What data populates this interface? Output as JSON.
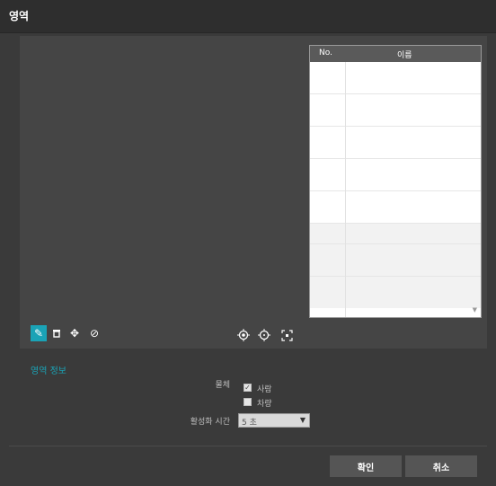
{
  "title": "영역",
  "table": {
    "headers": [
      "No.",
      "이름"
    ],
    "rows": [
      {
        "no": "",
        "name": ""
      },
      {
        "no": "",
        "name": ""
      },
      {
        "no": "",
        "name": ""
      },
      {
        "no": "",
        "name": ""
      },
      {
        "no": "",
        "name": ""
      },
      {
        "no": "",
        "name": ""
      },
      {
        "no": "",
        "name": ""
      },
      {
        "no": "",
        "name": ""
      }
    ]
  },
  "toolbar": {
    "left_icons": [
      "draw-icon",
      "delete-icon",
      "move-icon",
      "clear-icon"
    ],
    "right_icons": [
      "target-icon",
      "target-outline-icon",
      "fit-screen-icon"
    ],
    "active_color": "#1aa3b6"
  },
  "info": {
    "section_title": "영역 정보",
    "object_label": "물체",
    "checkboxes": [
      {
        "label": "사람",
        "checked": true
      },
      {
        "label": "차량",
        "checked": false
      }
    ],
    "activation_label": "활성화 시간",
    "activation_value": "5 초"
  },
  "buttons": {
    "ok": "확인",
    "cancel": "취소"
  }
}
